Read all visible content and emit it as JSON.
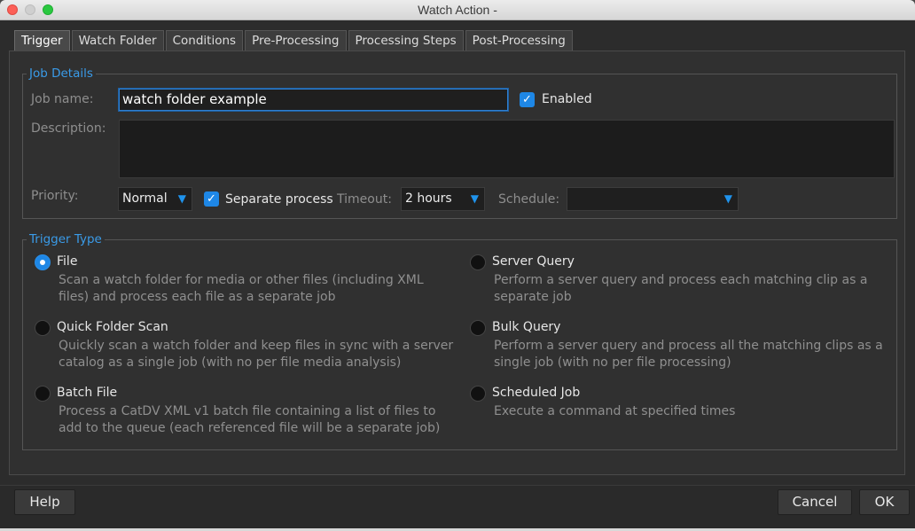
{
  "window": {
    "title": "Watch Action -"
  },
  "tabs": [
    {
      "label": "Trigger"
    },
    {
      "label": "Watch Folder"
    },
    {
      "label": "Conditions"
    },
    {
      "label": "Pre-Processing"
    },
    {
      "label": "Processing Steps"
    },
    {
      "label": "Post-Processing"
    }
  ],
  "job_details": {
    "legend": "Job Details",
    "job_name_label": "Job name:",
    "job_name_value": "watch folder example",
    "enabled_label": "Enabled",
    "enabled_checked": true,
    "description_label": "Description:",
    "description_value": "",
    "priority_label": "Priority:",
    "priority_value": "Normal",
    "separate_process_label": "Separate process",
    "separate_process_checked": true,
    "timeout_label": "Timeout:",
    "timeout_value": "2 hours",
    "schedule_label": "Schedule:",
    "schedule_value": ""
  },
  "trigger_type": {
    "legend": "Trigger Type",
    "selected": "File",
    "options": [
      {
        "title": "File",
        "desc": "Scan a watch folder for media or other files (including XML files) and process each file as a separate job"
      },
      {
        "title": "Server Query",
        "desc": "Perform a server query and process each matching clip as a separate job"
      },
      {
        "title": "Quick Folder Scan",
        "desc": "Quickly scan a watch folder and keep files in sync with a server catalog as a single job (with no per file media analysis)"
      },
      {
        "title": "Bulk Query",
        "desc": "Perform a server query and process all the matching clips as a single job (with no per file processing)"
      },
      {
        "title": "Batch File",
        "desc": "Process a CatDV XML v1 batch file containing a list of files to add to the queue (each referenced file will be a separate job)"
      },
      {
        "title": "Scheduled Job",
        "desc": "Execute a command at specified times"
      }
    ]
  },
  "footer": {
    "help_label": "Help",
    "cancel_label": "Cancel",
    "ok_label": "OK"
  }
}
